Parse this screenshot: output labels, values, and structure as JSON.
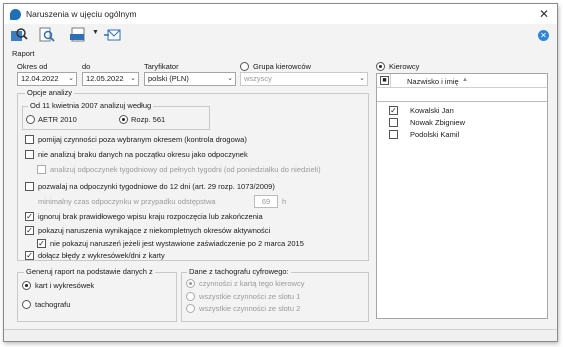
{
  "window": {
    "title": "Naruszenia w ujęciu ogólnym"
  },
  "raport": {
    "section_label": "Raport",
    "okres_od_label": "Okres od",
    "date_from": "12.04.2022",
    "do_label": "do",
    "date_to": "12.05.2022",
    "taryfikator_label": "Taryfikator",
    "taryfikator_value": "polski (PLN)",
    "grupa_label": "Grupa kierowców",
    "grupa_value": "wszyscy",
    "kierowcy_label": "Kierowcy"
  },
  "opcje": {
    "title": "Opcje analizy",
    "group_title": "Od 11 kwietnia 2007 analizuj według",
    "radio_aetr": "AETR 2010",
    "radio_rozp": "Rozp. 561",
    "opt1": "pomijaj czynności poza wybranym okresem (kontrola drogowa)",
    "opt2": "nie analizuj braku danych na początku okresu jako odpoczynek",
    "opt3": "analizuj odpoczynek tygodniowy od pełnych tygodni (od poniedziałku do niedzieli)",
    "opt4": "pozwalaj na odpoczynki tygodniowe do 12 dni (art. 29 rozp. 1073/2009)",
    "min_czas_label": "minimalny czas odpoczynku w przypadku odstępstwa",
    "min_czas_value": "69",
    "min_czas_unit": "h",
    "opt5": "ignoruj brak prawidłowego wpisu kraju rozpoczęcia lub zakończenia",
    "opt6": "pokazuj naruszenia wynikające z niekompletnych okresów aktywności",
    "opt7": "nie pokazuj naruszeń jeżeli jest wystawione zaświadczenie po 2 marca 2015",
    "opt8": "dołącz błędy z wykresówek/dni z karty"
  },
  "generuj": {
    "title": "Generuj raport na podstawie danych z",
    "r1": "kart i wykresówek",
    "r2": "tachografu"
  },
  "dane": {
    "title": "Dane z tachografu cyfrowego:",
    "r1": "czynności z kartą tego kierowcy",
    "r2": "wszystkie czynności ze slotu 1",
    "r3": "wszystkie czynności ze slotu 2"
  },
  "list": {
    "column": "Nazwisko i imię",
    "drivers": [
      {
        "name": "Kowalski Jan",
        "checked": true
      },
      {
        "name": "Nowak Zbigniew",
        "checked": false
      },
      {
        "name": "Podolski Kamil",
        "checked": false
      }
    ]
  },
  "icons": {
    "toolbar": [
      "report-search-icon",
      "preview-icon",
      "pdf-export-icon",
      "dropdown-arrow-icon",
      "send-icon"
    ],
    "close": "close-icon",
    "toolbar_close": "close-circle-icon"
  },
  "colors": {
    "accent": "#2f86d6",
    "app_icon": "#1e6fb8"
  }
}
